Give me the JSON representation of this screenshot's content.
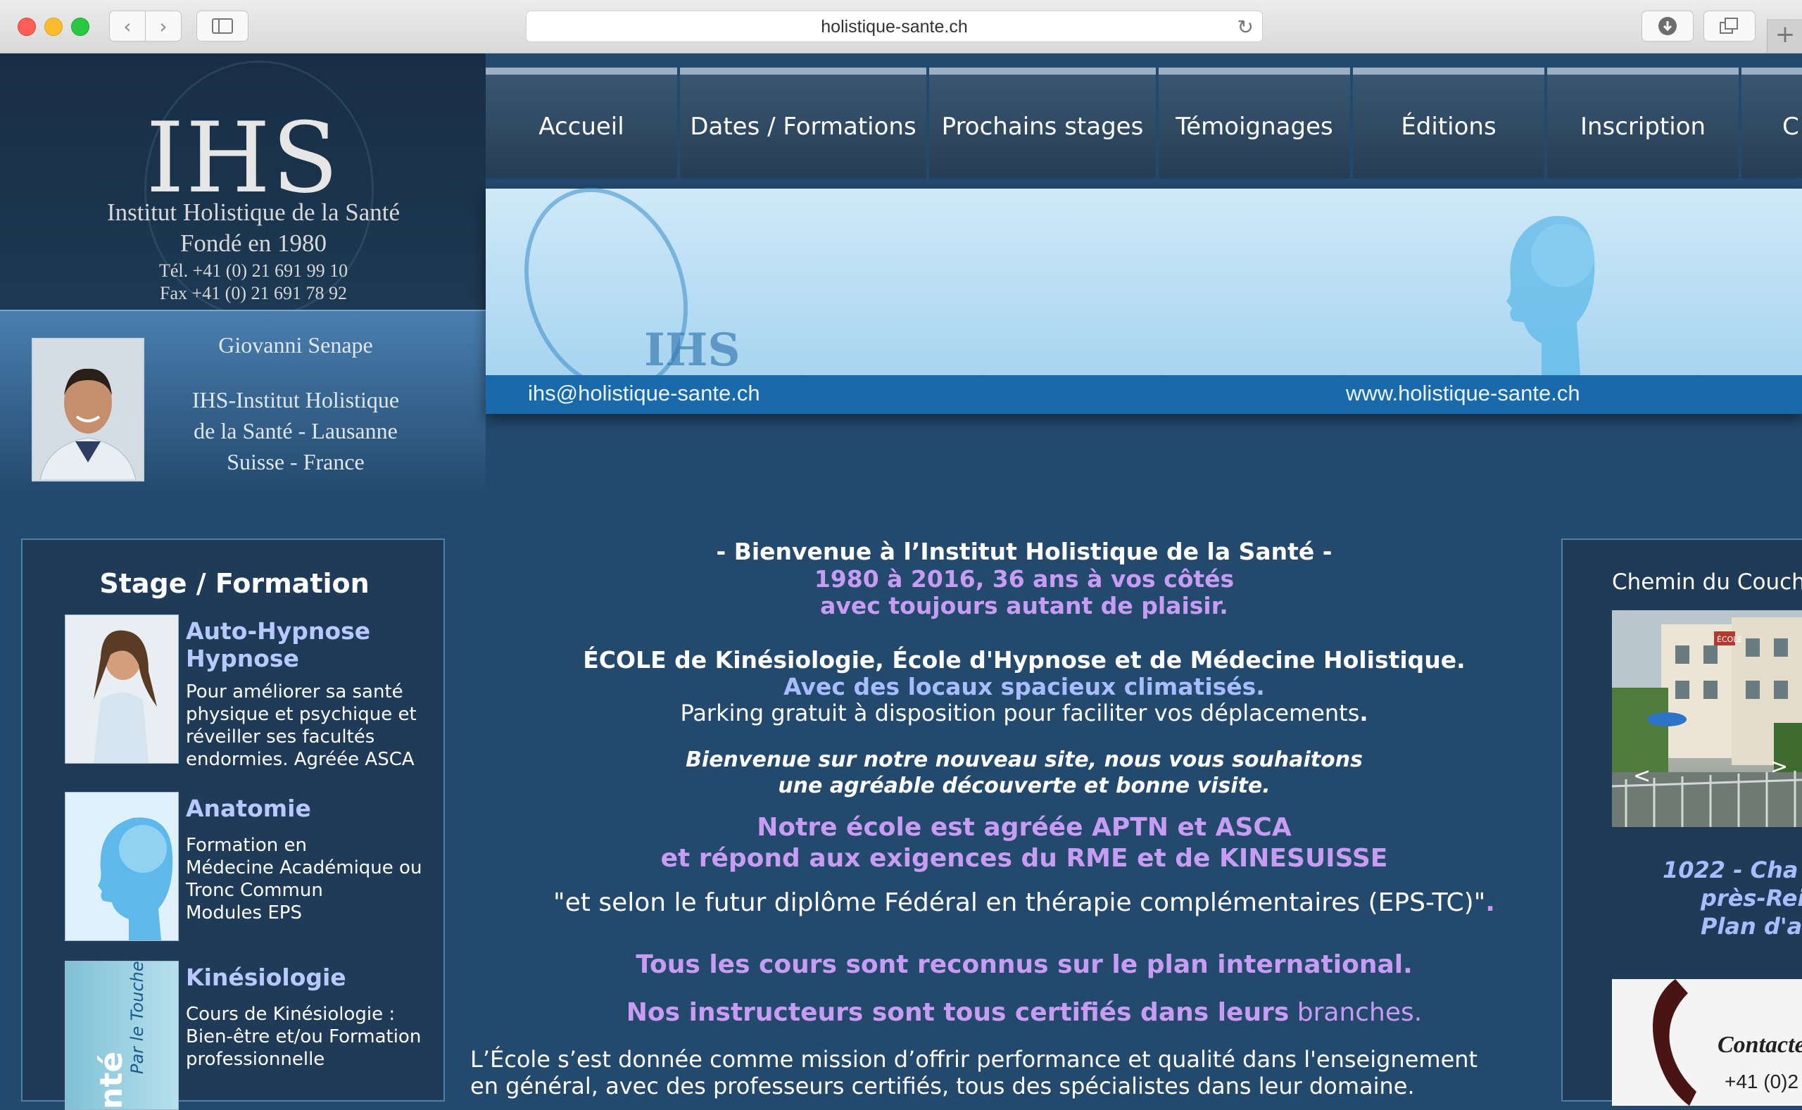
{
  "browser": {
    "url": "holistique-sante.ch",
    "back_icon": "‹",
    "forward_icon": "›",
    "newtab_icon": "+"
  },
  "header": {
    "logo_text": "IHS",
    "institute": "Institut Holistique de la Santé",
    "founded": "Fondé en 1980",
    "tel": "Tél. +41 (0) 21 691 99 10",
    "fax": "Fax +41 (0) 21 691 78 92",
    "person_name": "Giovanni Senape",
    "org_line1": "IHS-Institut Holistique",
    "org_line2": "de la Santé - Lausanne",
    "org_line3": "Suisse - France"
  },
  "nav": {
    "items": [
      {
        "label": "Accueil"
      },
      {
        "label": "Dates / Formations"
      },
      {
        "label": "Prochains stages"
      },
      {
        "label": "Témoignages"
      },
      {
        "label": "Éditions"
      },
      {
        "label": "Inscription"
      },
      {
        "label": "C"
      }
    ]
  },
  "banner": {
    "email": "ihs@holistique-sante.ch",
    "website": "www.holistique-sante.ch",
    "logo_text": "IHS"
  },
  "left_panel": {
    "title": "Stage / Formation",
    "items": [
      {
        "title_line1": "Auto-Hypnose",
        "title_line2": "Hypnose",
        "desc": [
          "Pour améliorer sa santé",
          "physique et psychique et",
          "réveiller ses facultés",
          "endormies. Agréée ASCA"
        ]
      },
      {
        "title_line1": "Anatomie",
        "desc": [
          "Formation en",
          "Médecine Académique ou",
          "Tronc Commun",
          "Modules EPS"
        ]
      },
      {
        "title_line1": "Kinésiologie",
        "desc": [
          "Cours de Kinésiologie :",
          "Bien-être et/ou Formation",
          "professionnelle"
        ]
      }
    ],
    "book_spine_text": "Par le Toucher",
    "book_spine_text2": "nté"
  },
  "main": {
    "welcome": "- Bienvenue à l’Institut Holistique de la Santé -",
    "years": "1980 à 2016, 36 ans à vos côtés",
    "pleasure": "avec toujours autant de plaisir.",
    "school": "ÉCOLE de Kinésiologie, École d'Hypnose et de Médecine Holistique.",
    "premises": "Avec des locaux spacieux climatisés.",
    "parking": "Parking gratuit à disposition pour faciliter vos déplacements",
    "parking_end": ".",
    "newsite_1": "Bienvenue sur notre nouveau site, nous vous souhaitons",
    "newsite_2": "une agréable découverte et bonne visite.",
    "approved_1": "Notre école est agréée APTN et ASCA",
    "approved_2": "et répond aux exigences du RME et de KINESUISSE",
    "federal": "\"et selon le futur diplôme Fédéral en thérapie complémentaires (EPS-TC)\"",
    "federal_end": ".",
    "intl": "Tous les cours sont reconnus sur le plan international.",
    "instructors": "Nos instructeurs sont tous certifiés dans leurs",
    "instructors_end": "branches.",
    "mission_1": "L’École s’est donnée comme mission d’offrir performance et qualité dans l'enseignement",
    "mission_2": "en général, avec des professeurs  certifiés, tous des spécialistes dans leur domaine."
  },
  "right_panel": {
    "title": "Chemin du Couch",
    "addr_1": "1022 - Cha",
    "addr_2": "près-Rei",
    "addr_3": "Plan d'a",
    "sign_text": "ÉCOLE",
    "contact_label": "Contacte",
    "contact_phone": "+41 (0)2"
  }
}
